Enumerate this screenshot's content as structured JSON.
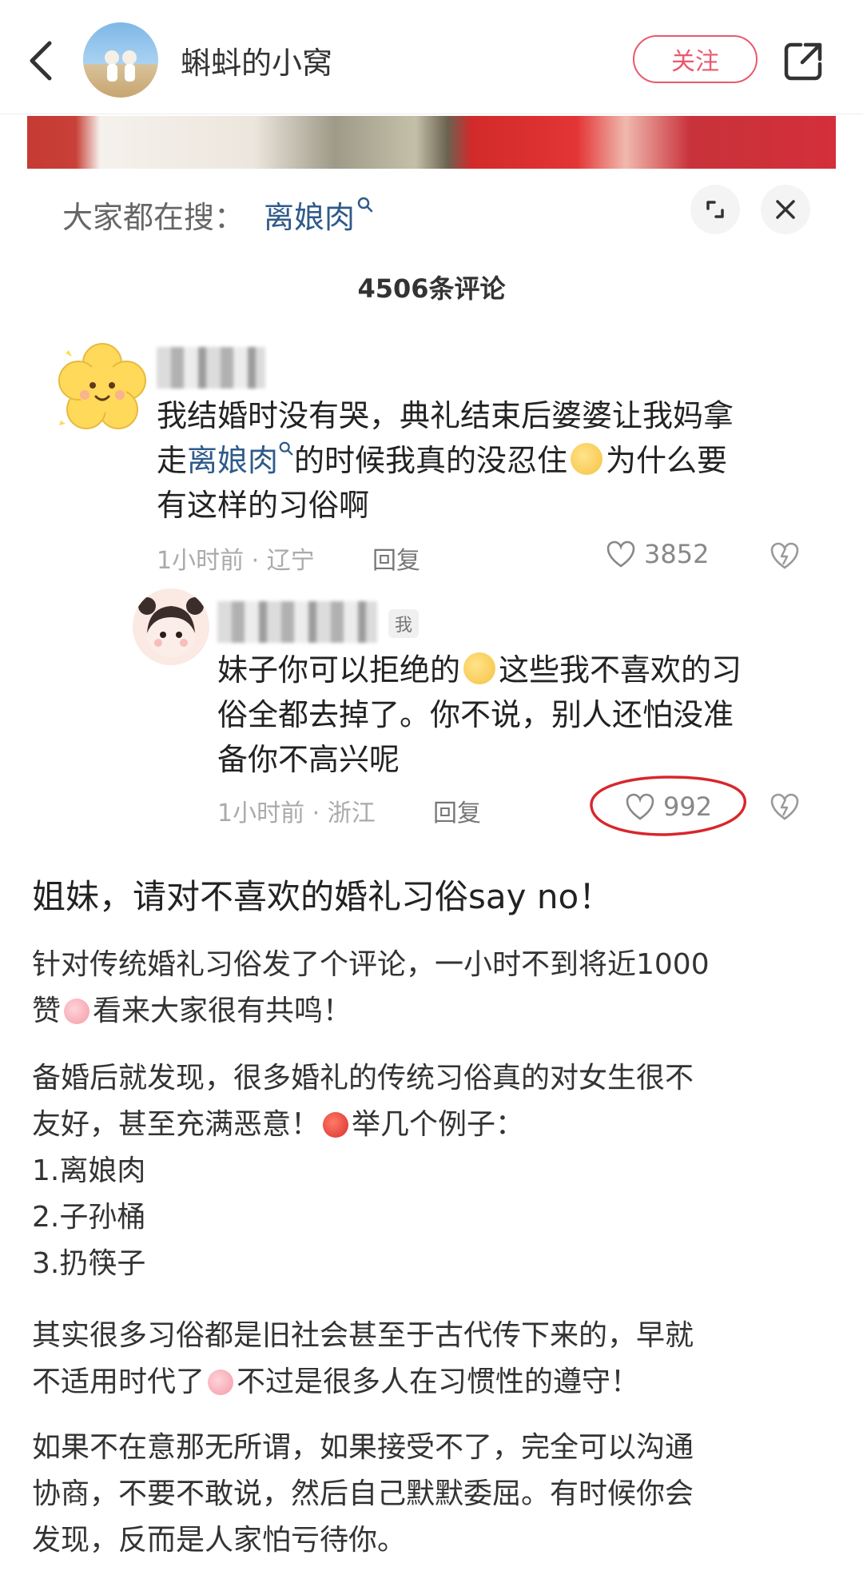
{
  "header": {
    "title": "蝌蚪的小窝",
    "follow_label": "关注"
  },
  "search_bar": {
    "label": "大家都在搜：",
    "term": "离娘肉"
  },
  "comments_count": "4506条评论",
  "comments": [
    {
      "text_line1": "我结婚时没有哭，典礼结束后婆婆让我妈拿",
      "text_line2_pre": "走",
      "text_line2_link": "离娘肉",
      "text_line2_post": "的时候我真的没忍住",
      "text_line2_tail": "为什么要",
      "text_line3": "有这样的习俗啊",
      "meta": "1小时前 · 辽宁",
      "reply_label": "回复",
      "likes": "3852"
    },
    {
      "badge": "我",
      "text_line1": "妹子你可以拒绝的",
      "text_line1_tail": "这些我不喜欢的习",
      "text_line2": "俗全都去掉了。你不说，别人还怕没准",
      "text_line3": "备你不高兴呢",
      "meta": "1小时前 · 浙江",
      "reply_label": "回复",
      "likes": "992"
    }
  ],
  "article": {
    "title": "姐妹，请对不喜欢的婚礼习俗say no！",
    "p1_line1": "针对传统婚礼习俗发了个评论，一小时不到将近1000",
    "p1_line2_pre": "赞",
    "p1_line2_post": "看来大家很有共鸣！",
    "p2_line1": "备婚后就发现，很多婚礼的传统习俗真的对女生很不",
    "p2_line2_pre": "友好，甚至充满恶意！",
    "p2_line2_post": "举几个例子：",
    "list": [
      "1.离娘肉",
      "2.子孙桶",
      "3.扔筷子"
    ],
    "p3_line1": "其实很多习俗都是旧社会甚至于古代传下来的，早就",
    "p3_line2_pre": "不适用时代了",
    "p3_line2_post": "不过是很多人在习惯性的遵守！",
    "p4_line1": "如果不在意那无所谓，如果接受不了，完全可以沟通",
    "p4_line2": "协商，不要不敢说，然后自己默默委屈。有时候你会",
    "p4_line3": "发现，反而是人家怕亏待你。"
  },
  "colors": {
    "accent": "#e9596e",
    "link": "#2f5a8a",
    "annotation_circle": "#d8262c"
  }
}
